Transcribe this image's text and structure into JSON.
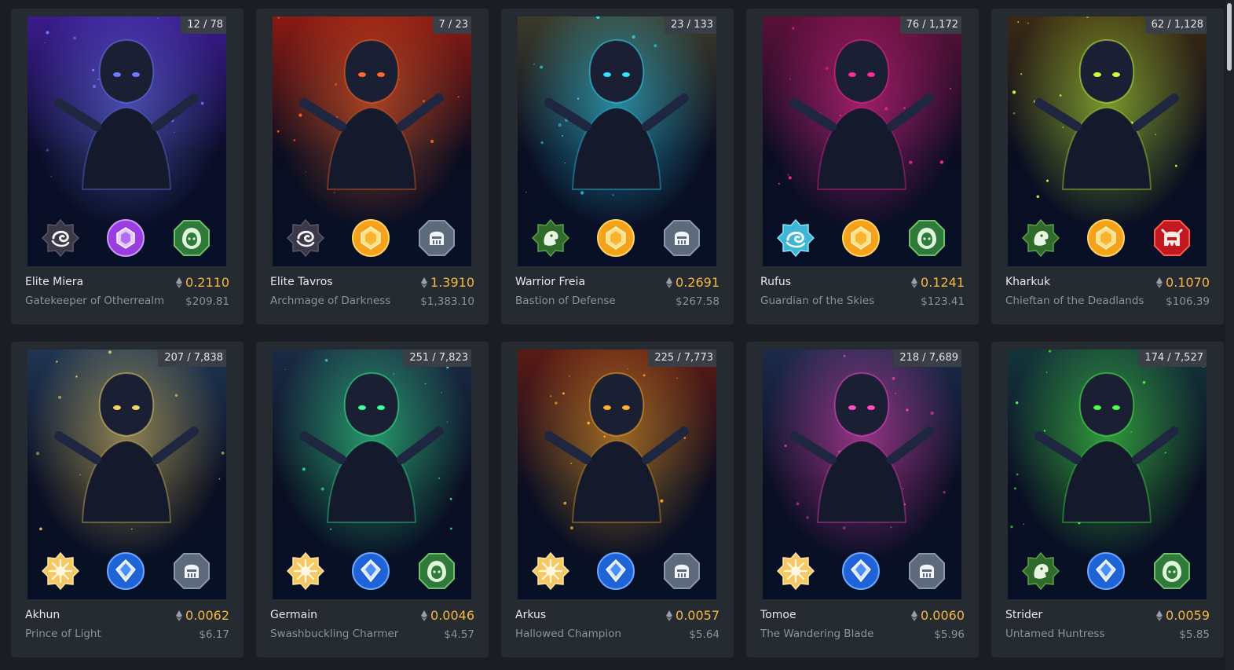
{
  "colors": {
    "page_bg": "#1a1d22",
    "card_bg": "#262a31",
    "price_accent": "#f5b83c",
    "muted_text": "#8c929b"
  },
  "cards": [
    {
      "name": "Elite Miera",
      "subtitle": "Gatekeeper of Otherrealm",
      "price_eth": "0.2110",
      "price_usd": "$209.81",
      "counter": "12 / 78",
      "art_colors": [
        "#3a1b8e",
        "#0a0d26"
      ],
      "glow": "#6e7bff",
      "badges": [
        "void-badge-icon",
        "violet-gem-badge-icon",
        "nature-hood-badge-icon"
      ]
    },
    {
      "name": "Elite Tavros",
      "subtitle": "Archmage of Darkness",
      "price_eth": "1.3910",
      "price_usd": "$1,383.10",
      "counter": "7 / 23",
      "art_colors": [
        "#8a1a12",
        "#0a0d20"
      ],
      "glow": "#ff6a2a",
      "badges": [
        "void-badge-icon",
        "gold-gem-badge-icon",
        "knight-helm-badge-icon"
      ]
    },
    {
      "name": "Warrior Freia",
      "subtitle": "Bastion of Defense",
      "price_eth": "0.2691",
      "price_usd": "$267.58",
      "counter": "23 / 133",
      "art_colors": [
        "#3b3a2a",
        "#0a0e22"
      ],
      "glow": "#33e0ff",
      "badges": [
        "beast-badge-icon",
        "gold-gem-badge-icon",
        "knight-helm-badge-icon"
      ]
    },
    {
      "name": "Rufus",
      "subtitle": "Guardian of the Skies",
      "price_eth": "0.1241",
      "price_usd": "$123.41",
      "counter": "76 / 1,172",
      "art_colors": [
        "#5a1038",
        "#0a0d22"
      ],
      "glow": "#ff2a9a",
      "badges": [
        "wind-badge-icon",
        "gold-gem-badge-icon",
        "nature-hood-badge-icon"
      ]
    },
    {
      "name": "Kharkuk",
      "subtitle": "Chieftan of the Deadlands",
      "price_eth": "0.1070",
      "price_usd": "$106.39",
      "counter": "62 / 1,128",
      "art_colors": [
        "#3a2a14",
        "#0a0d20"
      ],
      "glow": "#c9ff3a",
      "badges": [
        "beast-badge-icon",
        "gold-gem-badge-icon",
        "orc-helm-badge-icon"
      ]
    },
    {
      "name": "Akhun",
      "subtitle": "Prince of Light",
      "price_eth": "0.0062",
      "price_usd": "$6.17",
      "counter": "207 / 7,838",
      "art_colors": [
        "#1f3552",
        "#0a0f22"
      ],
      "glow": "#f2d36a",
      "badges": [
        "light-badge-icon",
        "blue-gem-badge-icon",
        "knight-helm-badge-icon"
      ]
    },
    {
      "name": "Germain",
      "subtitle": "Swashbuckling Charmer",
      "price_eth": "0.0046",
      "price_usd": "$4.57",
      "counter": "251 / 7,823",
      "art_colors": [
        "#1a2b44",
        "#0a0e22"
      ],
      "glow": "#3aff9c",
      "badges": [
        "light-badge-icon",
        "blue-gem-badge-icon",
        "nature-hood-badge-icon"
      ]
    },
    {
      "name": "Arkus",
      "subtitle": "Hallowed Champion",
      "price_eth": "0.0057",
      "price_usd": "$5.64",
      "counter": "225 / 7,773",
      "art_colors": [
        "#5a1a14",
        "#0a0e22"
      ],
      "glow": "#ffb02a",
      "badges": [
        "light-badge-icon",
        "blue-gem-badge-icon",
        "knight-helm-badge-icon"
      ]
    },
    {
      "name": "Tomoe",
      "subtitle": "The Wandering Blade",
      "price_eth": "0.0060",
      "price_usd": "$5.96",
      "counter": "218 / 7,689",
      "art_colors": [
        "#1c2a4a",
        "#0a0e22"
      ],
      "glow": "#ff4ac8",
      "badges": [
        "light-badge-icon",
        "blue-gem-badge-icon",
        "knight-helm-badge-icon"
      ]
    },
    {
      "name": "Strider",
      "subtitle": "Untamed Huntress",
      "price_eth": "0.0059",
      "price_usd": "$5.85",
      "counter": "174 / 7,527",
      "art_colors": [
        "#14343a",
        "#0a0e22"
      ],
      "glow": "#4dff4a",
      "badges": [
        "beast-badge-icon",
        "blue-gem-badge-icon",
        "nature-hood-badge-icon"
      ]
    }
  ]
}
